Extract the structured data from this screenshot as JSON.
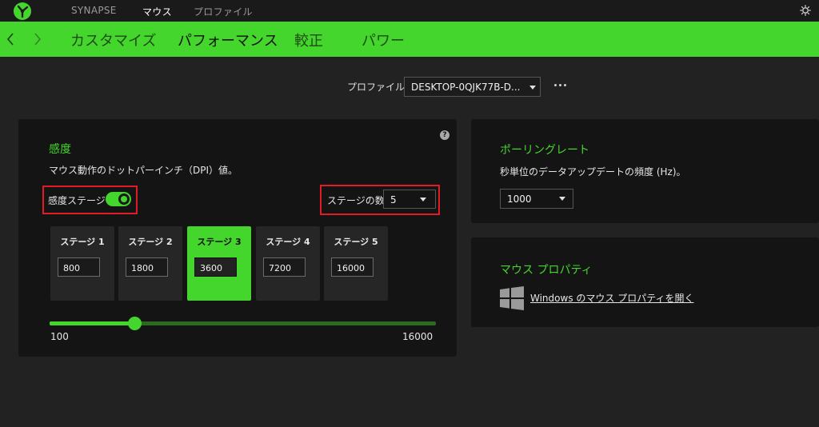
{
  "topnav": {
    "tabs": [
      "SYNAPSE",
      "マウス",
      "プロファイル"
    ],
    "active_tab": "マウス"
  },
  "subnav": {
    "tabs": [
      "カスタマイズ",
      "パフォーマンス",
      "較正",
      "パワー"
    ],
    "active_tab": "パフォーマンス"
  },
  "profile": {
    "label": "プロファイル",
    "selected": "DESKTOP-0QJK77B-D..."
  },
  "sensitivity": {
    "title": "感度",
    "description": "マウス動作のドットパーインチ（DPI）値。",
    "stages_toggle_label": "感度ステージ",
    "stages_enabled": true,
    "stage_count_label": "ステージの数",
    "stage_count": "5",
    "stages": [
      {
        "label": "ステージ 1",
        "value": "800"
      },
      {
        "label": "ステージ 2",
        "value": "1800"
      },
      {
        "label": "ステージ 3",
        "value": "3600"
      },
      {
        "label": "ステージ 4",
        "value": "7200"
      },
      {
        "label": "ステージ 5",
        "value": "16000"
      }
    ],
    "active_stage": 3,
    "slider": {
      "min": "100",
      "max": "16000",
      "value": 3600
    }
  },
  "polling": {
    "title": "ポーリングレート",
    "description": "秒単位のデータアップデートの頻度 (Hz)。",
    "selected": "1000"
  },
  "mouse_properties": {
    "title": "マウス プロパティ",
    "link": "Windows のマウス プロパティを開く"
  },
  "colors": {
    "accent": "#44d62c",
    "highlight_box": "#e11c24",
    "background": "#222222",
    "panel": "#141414"
  },
  "icons": {
    "logo": "razer-logo-icon",
    "settings": "gear-icon",
    "back": "chevron-left-icon",
    "forward": "chevron-right-icon",
    "more": "more-horizontal-icon",
    "help": "help-icon",
    "windows": "windows-icon"
  }
}
